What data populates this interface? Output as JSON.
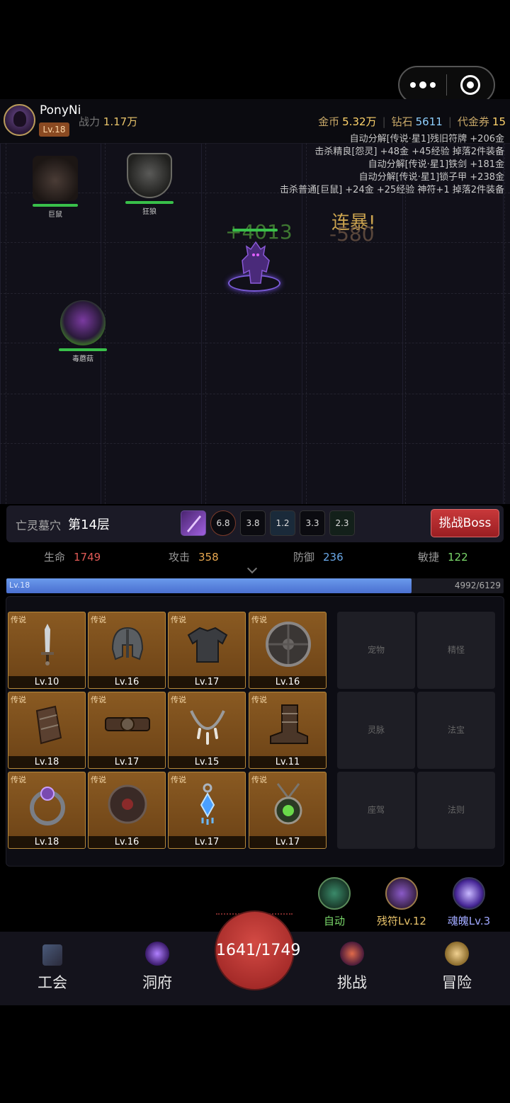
{
  "player": {
    "name": "PonyNi",
    "level": "Lv.18",
    "power_label": "战力",
    "power_value": "1.17万"
  },
  "currency": {
    "gold_label": "金币",
    "gold_value": "5.32万",
    "diamond_label": "钻石",
    "diamond_value": "5611",
    "voucher_label": "代金券",
    "voucher_value": "15"
  },
  "battle_log": [
    "自动分解[传说·星1]残旧符牌 +206金",
    "击杀精良[怨灵] +48金 +45经验 掉落2件装备",
    "自动分解[传说·星1]铁剑 +181金",
    "自动分解[传说·星1]锁子甲 +238金",
    "击杀普通[巨鼠] +24金 +25经验 神符+1 掉落2件装备"
  ],
  "monsters": [
    {
      "name": "巨鼠"
    },
    {
      "name": "狂狼"
    },
    {
      "name": "毒蘑菇"
    }
  ],
  "floating_text": {
    "heal": "+4013",
    "combo": "连暴!",
    "damage": "-580"
  },
  "dungeon": {
    "name": "亡灵墓穴",
    "floor": "第14层",
    "skills": [
      "6.8",
      "3.8",
      "1.2",
      "3.3",
      "2.3"
    ],
    "boss_button": "挑战Boss"
  },
  "stats": {
    "hp_label": "生命",
    "hp_value": "1749",
    "atk_label": "攻击",
    "atk_value": "358",
    "def_label": "防御",
    "def_value": "236",
    "agi_label": "敏捷",
    "agi_value": "122"
  },
  "exp": {
    "level": "Lv.18",
    "text": "4992/6129",
    "fraction": 0.8145
  },
  "equipment": [
    {
      "tag": "传说",
      "level": "Lv.10",
      "icon": "sword-icon"
    },
    {
      "tag": "传说",
      "level": "Lv.16",
      "icon": "helmet-icon"
    },
    {
      "tag": "传说",
      "level": "Lv.17",
      "icon": "shirt-icon"
    },
    {
      "tag": "传说",
      "level": "Lv.16",
      "icon": "shield-icon"
    },
    {
      "tag": "传说",
      "level": "Lv.18",
      "icon": "bracer-icon"
    },
    {
      "tag": "传说",
      "level": "Lv.17",
      "icon": "belt-icon"
    },
    {
      "tag": "传说",
      "level": "Lv.15",
      "icon": "necklace-icon"
    },
    {
      "tag": "传说",
      "level": "Lv.11",
      "icon": "boots-icon"
    },
    {
      "tag": "传说",
      "level": "Lv.18",
      "icon": "ring-icon"
    },
    {
      "tag": "传说",
      "level": "Lv.16",
      "icon": "talisman-icon"
    },
    {
      "tag": "传说",
      "level": "Lv.17",
      "icon": "earring-icon"
    },
    {
      "tag": "传说",
      "level": "Lv.17",
      "icon": "amulet-icon"
    }
  ],
  "locked_slots": [
    "宠物",
    "精怪",
    "灵脉",
    "法宝",
    "座驾",
    "法则"
  ],
  "quick_buttons": {
    "auto": "自动",
    "rune": "残符Lv.12",
    "soul": "魂魄Lv.3"
  },
  "nav": {
    "guild": "工会",
    "cave": "洞府",
    "hp": "1641/1749",
    "challenge": "挑战",
    "adventure": "冒险"
  },
  "colors": {
    "hp": "#e05a56",
    "atk": "#e8a850",
    "def": "#6aa8e8",
    "agi": "#7ad86a",
    "accent_gold": "#ffd36b",
    "legendary_frame": "#b88a3a"
  }
}
